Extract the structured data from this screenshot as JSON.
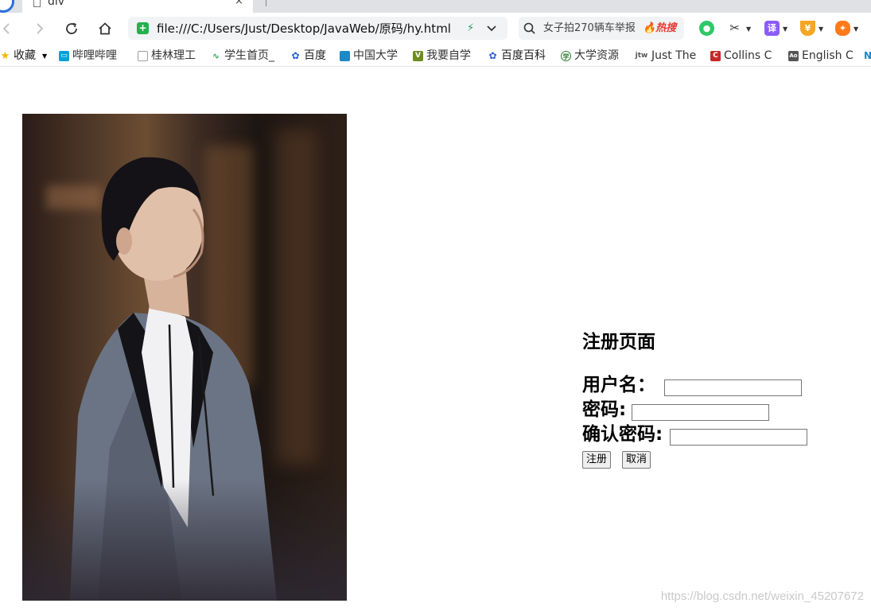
{
  "tab": {
    "title": "div",
    "close": "×"
  },
  "address_bar": {
    "url": "file:///C:/Users/Just/Desktop/JavaWeb/原码/hy.html",
    "bolt": "⚡"
  },
  "search": {
    "text": "女子拍270辆车举报",
    "hot": "🔥热搜"
  },
  "extensions": [
    {
      "name": "wechat-icon",
      "color": "#2ec866",
      "glyph": "●"
    },
    {
      "name": "scissors-icon",
      "color": "#ffffff",
      "glyph": "✂"
    },
    {
      "name": "translate-icon",
      "color": "#8a5cf6",
      "glyph": "译"
    },
    {
      "name": "coupon-icon",
      "color": "#f5a623",
      "glyph": "¥"
    },
    {
      "name": "game-icon",
      "color": "#ff7a1a",
      "glyph": "✦"
    }
  ],
  "bookmarks": [
    {
      "label": "收藏",
      "icon": "star",
      "color": "#f5b400"
    },
    {
      "label": "哔哩哔哩",
      "icon": "bilibili",
      "color": "#00a1d6"
    },
    {
      "label": "桂林理工",
      "icon": "page",
      "color": "#9e9e9e"
    },
    {
      "label": "学生首页_",
      "icon": "wave",
      "color": "#3aa757"
    },
    {
      "label": "百度",
      "icon": "baidu",
      "color": "#2a5dd9"
    },
    {
      "label": "中国大学",
      "icon": "mooc",
      "color": "#1e88c7"
    },
    {
      "label": "我要自学",
      "icon": "zx",
      "color": "#6e8b1f"
    },
    {
      "label": "百度百科",
      "icon": "baidu",
      "color": "#2a5dd9"
    },
    {
      "label": "大学资源",
      "icon": "globe",
      "color": "#2e7d32"
    },
    {
      "label": "Just The",
      "icon": "jtw",
      "color": "#555555"
    },
    {
      "label": "Collins C",
      "icon": "collins",
      "color": "#c62828"
    },
    {
      "label": "English C",
      "icon": "doc",
      "color": "#555555"
    }
  ],
  "form": {
    "title": "注册页面",
    "username_label": "用户名：",
    "password_label": "密码:",
    "confirm_label": "确认密码:",
    "username_value": "",
    "password_value": "",
    "confirm_value": "",
    "submit_label": "注册",
    "cancel_label": "取消"
  },
  "watermark": "https://blog.csdn.net/weixin_45207672"
}
